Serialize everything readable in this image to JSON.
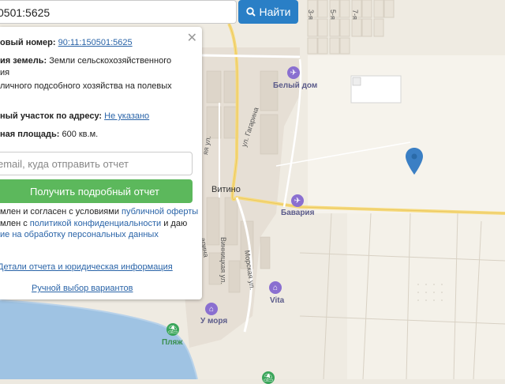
{
  "search": {
    "value": "0501:5625",
    "button_label": "Найти"
  },
  "panel": {
    "cadastral_label": "овый номер:",
    "cadastral_value": "90:11:150501:5625",
    "category_label": "ия земель:",
    "category_value_line1": "Земли сельскохозяйственного",
    "category_value_line2": "ия",
    "usage_line": "личного подсобного хозяйства на полевых",
    "address_label": "ный участок по адресу:",
    "address_value": "Не указано",
    "area_label": "ная площадь:",
    "area_value": "600 кв.м.",
    "email_placeholder": "email, куда отправить отчет",
    "report_button": "Получить подробный отчет",
    "terms1_a": "млен и согласен с условиями ",
    "terms1_link": "публичной оферты",
    "terms2_a": "млен с ",
    "terms2_link": "политикой конфиденциальности",
    "terms2_b": " и даю",
    "terms3_link": "ие на обработку персональных данных",
    "details_link": "Детали отчета и юридическая информация",
    "manual_link": "Ручной выбор вариантов"
  },
  "map": {
    "labels": {
      "belyi_dom": "Белый дом",
      "vitino": "Витино",
      "bavariya": "Бавария",
      "vita": "Vita",
      "u_morya": "У моря",
      "plyazh": "Пляж"
    },
    "streets": {
      "gagarina": "ул. Гагарина",
      "vinnitskaya": "Винницкая ул.",
      "morskaya": "Морская ул.",
      "left1": "яя ул.",
      "left2": "арина",
      "top1": "3-я",
      "top2": "5-я",
      "top3": "7-я"
    }
  },
  "colors": {
    "accent": "#2a7fc6",
    "report_button": "#5cb85c",
    "link": "#2a64a8",
    "marker": "#3b7fc4",
    "water": "#9fc3e3"
  }
}
